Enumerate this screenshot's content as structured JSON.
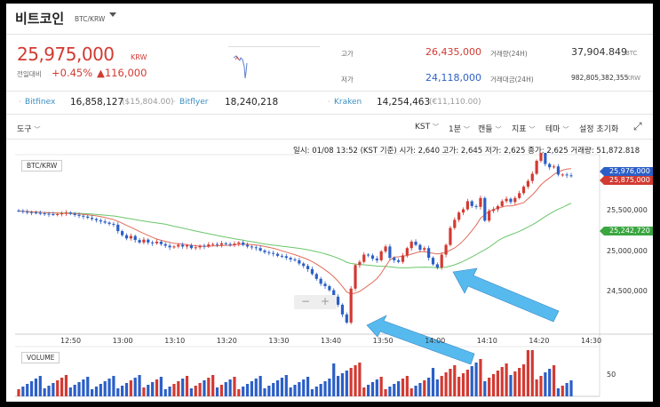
{
  "header": {
    "title": "비트코인",
    "symbol": "BTC/KRW"
  },
  "price": {
    "value": "25,975,000",
    "unit": "KRW",
    "change_label": "전일대비",
    "change_pct": "+0.45%",
    "change_amt": "▲116,000"
  },
  "stats": {
    "high_label": "고가",
    "high_value": "26,435,000",
    "low_label": "저가",
    "low_value": "24,118,000",
    "volume_label": "거래량(24H)",
    "volume_value": "37,904.849",
    "volume_unit": "BTC",
    "amount_label": "거래대금(24H)",
    "amount_value": "982,805,382,355",
    "amount_unit": "KRW"
  },
  "exchanges": [
    {
      "name": "Bitfinex",
      "krw": "16,858,127",
      "usd": "($15,804.00)"
    },
    {
      "name": "Bitflyer",
      "krw": "18,240,218",
      "usd": ""
    },
    {
      "name": "Kraken",
      "krw": "14,254,463",
      "usd": "(€11,110.00)"
    }
  ],
  "toolbar": {
    "tools": "도구",
    "timezone": "KST",
    "interval": "1분",
    "chart_type": "캔들",
    "indicators": "지표",
    "theme": "테마",
    "reset": "설정 초기화"
  },
  "info_bar": "일시: 01/08 13:52 (KST 기준)  시가: 2,640  고가: 2,645  저가: 2,625  종가: 2,625  거래량: 51,872.818",
  "chart_badge": "BTC/KRW",
  "volume_badge": "VOLUME",
  "y_ticks": [
    "25,500,000",
    "25,000,000",
    "24,500,000"
  ],
  "x_ticks": [
    "12:50",
    "13:00",
    "13:10",
    "13:20",
    "13:30",
    "13:40",
    "13:50",
    "14:00",
    "14:10",
    "14:20",
    "14:30"
  ],
  "tags": {
    "last": "25,976,000",
    "ma_short": "25,875,000",
    "ma_long": "25,242,720"
  },
  "volume_tick": "50",
  "colors": {
    "up": "#d23a32",
    "down": "#2b5fc7",
    "ma_short": "#e06c5a",
    "ma_long": "#6ac66a",
    "arrow": "#4fb7ee"
  },
  "chart_data": {
    "type": "candlestick",
    "x": [
      "12:50",
      "13:00",
      "13:10",
      "13:20",
      "13:30",
      "13:40",
      "13:50",
      "14:00",
      "14:10",
      "14:20",
      "14:30"
    ],
    "ylim": [
      24100000,
      26500000
    ],
    "yticks": [
      24500000,
      25000000,
      25500000
    ]
  }
}
